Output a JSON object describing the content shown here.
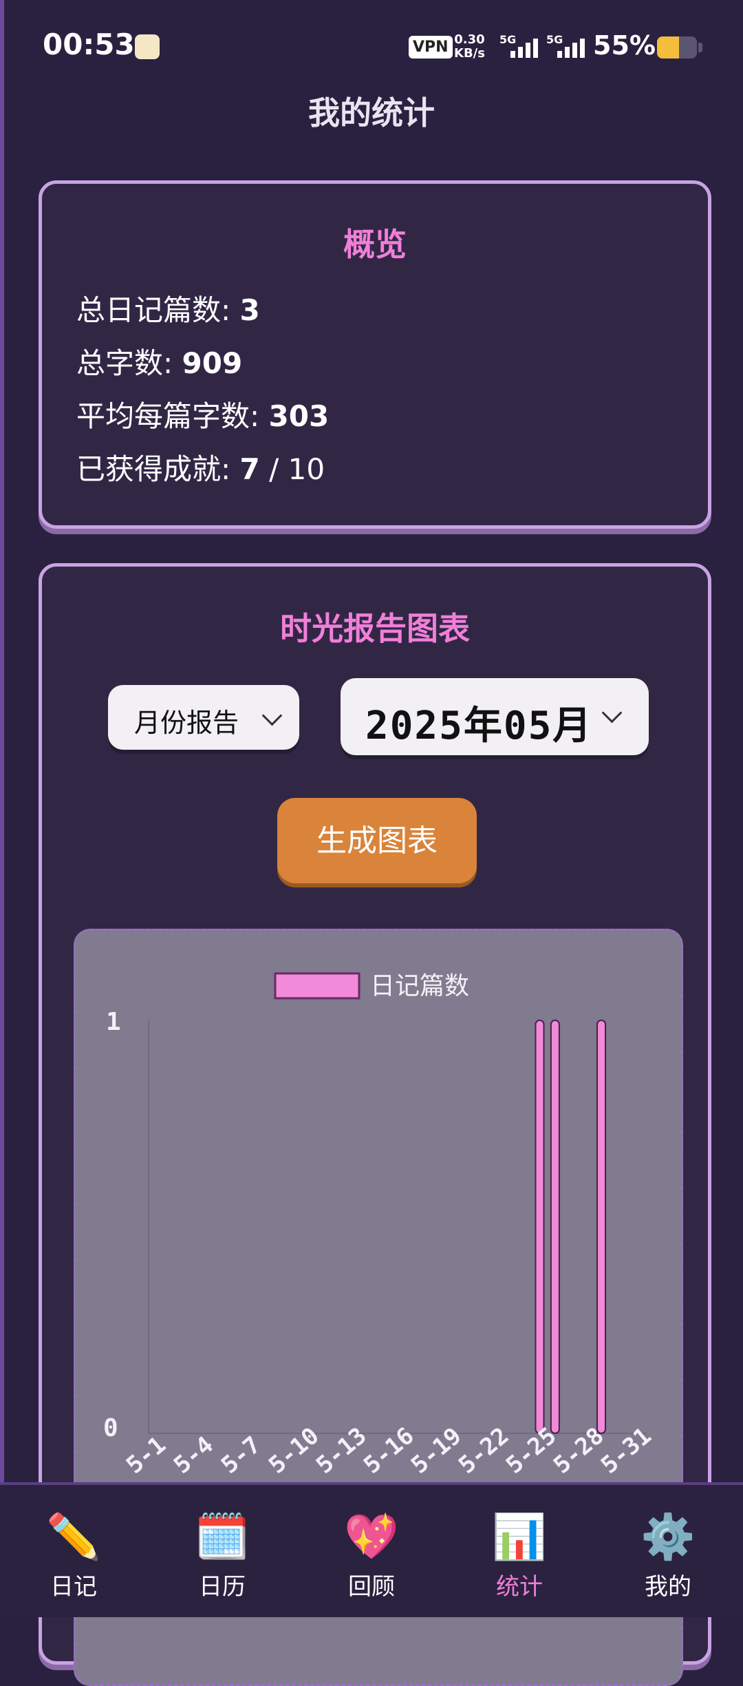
{
  "status_bar": {
    "time": "00:53",
    "vpn": "VPN",
    "net_speed_value": "0.30",
    "net_speed_unit": "KB/s",
    "signal1": "5G",
    "signal2": "5G",
    "battery_percent": "55%",
    "battery_level": 0.55,
    "battery_color": "#f2be3c"
  },
  "header": {
    "title": "我的统计"
  },
  "overview": {
    "title": "概览",
    "stats": [
      {
        "label": "总日记篇数: ",
        "value": "3"
      },
      {
        "label": "总字数: ",
        "value": "909"
      },
      {
        "label": "平均每篇字数: ",
        "value": "303"
      },
      {
        "label": "已获得成就: ",
        "value": "7",
        "suffix": " / 10"
      }
    ]
  },
  "report": {
    "title": "时光报告图表",
    "report_type": "月份报告",
    "month": "2025年05月",
    "generate_label": "生成图表"
  },
  "chart_data": {
    "type": "bar",
    "series": [
      {
        "name": "日记篇数",
        "color": "#f08ad9"
      }
    ],
    "ylim": [
      0,
      1
    ],
    "y_ticks": [
      "1",
      "0"
    ],
    "x_tick_labels": [
      "5-1",
      "5-4",
      "5-7",
      "5-10",
      "5-13",
      "5-16",
      "5-19",
      "5-22",
      "5-25",
      "5-28",
      "5-31"
    ],
    "days": 31,
    "values": [
      0,
      0,
      0,
      0,
      0,
      0,
      0,
      0,
      0,
      0,
      0,
      0,
      0,
      0,
      0,
      0,
      0,
      0,
      0,
      0,
      0,
      0,
      0,
      0,
      1,
      1,
      0,
      0,
      1,
      0,
      0
    ]
  },
  "nav": {
    "items": [
      {
        "label": "日记",
        "icon": "pencil-icon",
        "glyph": "✏️"
      },
      {
        "label": "日历",
        "icon": "calendar-icon",
        "glyph": "🗓️"
      },
      {
        "label": "回顾",
        "icon": "sparkling-heart-icon",
        "glyph": "💖"
      },
      {
        "label": "统计",
        "icon": "bar-chart-icon",
        "glyph": "📊"
      },
      {
        "label": "我的",
        "icon": "gear-icon",
        "glyph": "⚙️"
      }
    ],
    "active_index": 3,
    "active_color": "#f07fd8"
  }
}
